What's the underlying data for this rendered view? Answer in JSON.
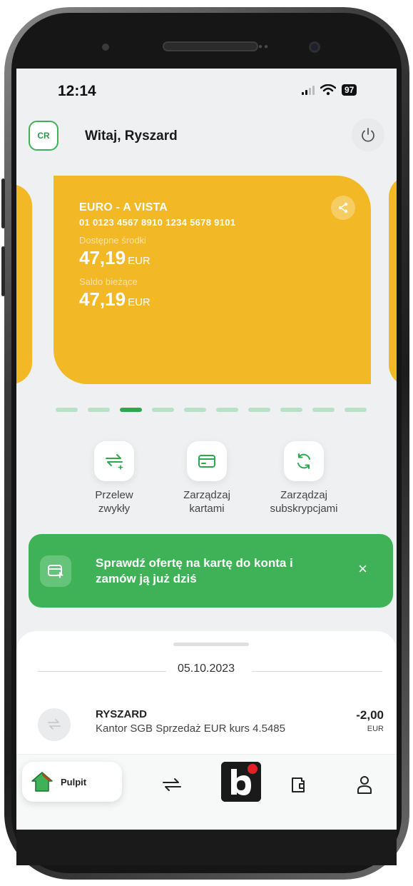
{
  "status_bar": {
    "time": "12:14",
    "battery": "97"
  },
  "header": {
    "avatar_initials": "CR",
    "greeting": "Witaj, Ryszard"
  },
  "account_card": {
    "name": "EURO - A VISTA",
    "number": "01 0123 4567 8910 1234 5678 9101",
    "available_label": "Dostępne środki",
    "available_amount": "47,19",
    "available_currency": "EUR",
    "balance_label": "Saldo bieżące",
    "balance_amount": "47,19",
    "balance_currency": "EUR",
    "color": "#f2b825"
  },
  "pager": {
    "count": 10,
    "active_index": 2,
    "active_color": "#2ea74f"
  },
  "quick_actions": [
    {
      "icon": "transfer-icon",
      "label_line1": "Przelew",
      "label_line2": "zwykły"
    },
    {
      "icon": "card-icon",
      "label_line1": "Zarządzaj",
      "label_line2": "kartami"
    },
    {
      "icon": "refresh-icon",
      "label_line1": "Zarządzaj",
      "label_line2": "subskrypcjami"
    }
  ],
  "banner": {
    "text": "Sprawdź ofertę na kartę do konta i zamów ją już dziś",
    "close": "×",
    "color": "#3fb257"
  },
  "transactions": {
    "date": "05.10.2023",
    "items": [
      {
        "name": "RYSZARD",
        "description": "Kantor SGB Sprzedaż EUR kurs 4.5485",
        "amount": "-2,00",
        "currency": "EUR"
      }
    ]
  },
  "bottom_nav": {
    "home_label": "Pulpit",
    "items": [
      "transfers-icon",
      "bank-logo-icon",
      "wallet-icon",
      "profile-icon"
    ]
  }
}
